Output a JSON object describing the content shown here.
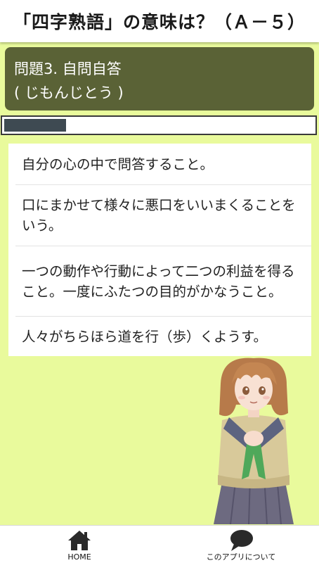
{
  "app_bar": {
    "title": "「四字熟語」の意味は？（Ａ－５）"
  },
  "question": {
    "line1": "問題3. 自問自答",
    "line2": "( じもんじとう )"
  },
  "progress": {
    "fraction": 0.2
  },
  "options": [
    {
      "text": "自分の心の中で問答すること。"
    },
    {
      "text": "口にまかせて様々に悪口をいいまくることをいう。"
    },
    {
      "text": "一つの動作や行動によって二つの利益を得ること。一度にふたつの目的がかなうこと。"
    },
    {
      "text": "人々がちらほら道を行（歩）くようす。"
    }
  ],
  "illustration": {
    "icon": "anime-girl-illustration"
  },
  "bottom_nav": {
    "home_label": "HOME",
    "home_icon": "home-icon",
    "about_label": "このアプリについて",
    "about_icon": "speech-bubble-icon"
  },
  "colors": {
    "background": "#e9fa9c",
    "question_card": "#5a6236",
    "progress_fill": "#3e4a52"
  }
}
